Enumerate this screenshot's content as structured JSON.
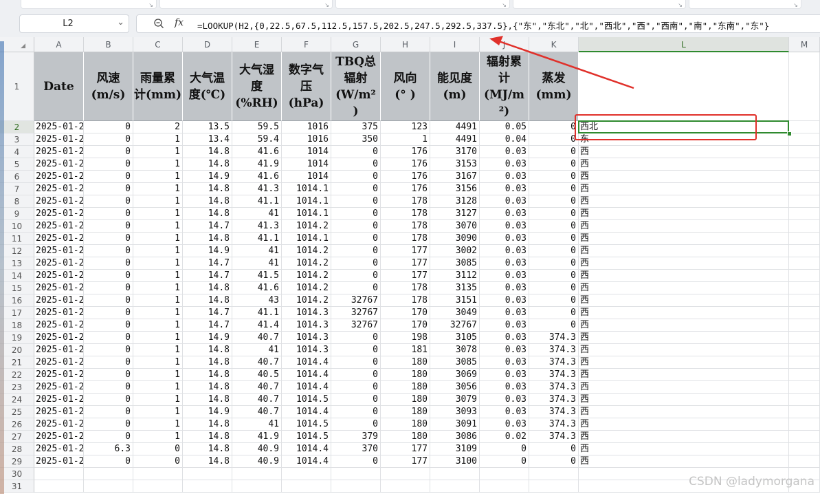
{
  "name_box": {
    "value": "L2"
  },
  "formula_bar": {
    "fx_label": "fx",
    "formula": "=LOOKUP(H2,{0,22.5,67.5,112.5,157.5,202.5,247.5,292.5,337.5},{\"东\",\"东北\",\"北\",\"西北\",\"西\",\"西南\",\"南\",\"东南\",\"东\"}"
  },
  "columns": [
    "A",
    "B",
    "C",
    "D",
    "E",
    "F",
    "G",
    "H",
    "I",
    "J",
    "K",
    "L",
    "M"
  ],
  "selected_column": "L",
  "selected_row": 2,
  "headers": [
    "Date",
    "风速\n(m/s)",
    "雨量累\n计(mm)",
    "大气温\n度(℃)",
    "大气湿\n度\n(%RH)",
    "数字气\n压\n(hPa)",
    "TBQ总\n辐射\n(W/m²\n)",
    "风向\n(° )",
    "能见度\n(m)",
    "辐射累\n计\n(MJ/m\n²)",
    "蒸发\n(mm)"
  ],
  "rows": [
    [
      "2025-01-2",
      "0",
      "2",
      "13.5",
      "59.5",
      "1016",
      "375",
      "123",
      "4491",
      "0.05",
      "0",
      "西北"
    ],
    [
      "2025-01-2",
      "0",
      "1",
      "13.4",
      "59.4",
      "1016",
      "350",
      "1",
      "4491",
      "0.04",
      "0",
      "东"
    ],
    [
      "2025-01-2",
      "0",
      "1",
      "14.8",
      "41.6",
      "1014",
      "0",
      "176",
      "3170",
      "0.03",
      "0",
      "西"
    ],
    [
      "2025-01-2",
      "0",
      "1",
      "14.8",
      "41.9",
      "1014",
      "0",
      "176",
      "3153",
      "0.03",
      "0",
      "西"
    ],
    [
      "2025-01-2",
      "0",
      "1",
      "14.9",
      "41.6",
      "1014",
      "0",
      "176",
      "3167",
      "0.03",
      "0",
      "西"
    ],
    [
      "2025-01-2",
      "0",
      "1",
      "14.8",
      "41.3",
      "1014.1",
      "0",
      "176",
      "3156",
      "0.03",
      "0",
      "西"
    ],
    [
      "2025-01-2",
      "0",
      "1",
      "14.8",
      "41.1",
      "1014.1",
      "0",
      "178",
      "3128",
      "0.03",
      "0",
      "西"
    ],
    [
      "2025-01-2",
      "0",
      "1",
      "14.8",
      "41",
      "1014.1",
      "0",
      "178",
      "3127",
      "0.03",
      "0",
      "西"
    ],
    [
      "2025-01-2",
      "0",
      "1",
      "14.7",
      "41.3",
      "1014.2",
      "0",
      "178",
      "3070",
      "0.03",
      "0",
      "西"
    ],
    [
      "2025-01-2",
      "0",
      "1",
      "14.8",
      "41.1",
      "1014.1",
      "0",
      "178",
      "3090",
      "0.03",
      "0",
      "西"
    ],
    [
      "2025-01-2",
      "0",
      "1",
      "14.9",
      "41",
      "1014.2",
      "0",
      "177",
      "3002",
      "0.03",
      "0",
      "西"
    ],
    [
      "2025-01-2",
      "0",
      "1",
      "14.7",
      "41",
      "1014.2",
      "0",
      "177",
      "3085",
      "0.03",
      "0",
      "西"
    ],
    [
      "2025-01-2",
      "0",
      "1",
      "14.7",
      "41.5",
      "1014.2",
      "0",
      "177",
      "3112",
      "0.03",
      "0",
      "西"
    ],
    [
      "2025-01-2",
      "0",
      "1",
      "14.8",
      "41.6",
      "1014.2",
      "0",
      "178",
      "3135",
      "0.03",
      "0",
      "西"
    ],
    [
      "2025-01-2",
      "0",
      "1",
      "14.8",
      "43",
      "1014.2",
      "32767",
      "178",
      "3151",
      "0.03",
      "0",
      "西"
    ],
    [
      "2025-01-2",
      "0",
      "1",
      "14.7",
      "41.1",
      "1014.3",
      "32767",
      "170",
      "3049",
      "0.03",
      "0",
      "西"
    ],
    [
      "2025-01-2",
      "0",
      "1",
      "14.7",
      "41.4",
      "1014.3",
      "32767",
      "170",
      "32767",
      "0.03",
      "0",
      "西"
    ],
    [
      "2025-01-2",
      "0",
      "1",
      "14.9",
      "40.7",
      "1014.3",
      "0",
      "198",
      "3105",
      "0.03",
      "374.3",
      "西"
    ],
    [
      "2025-01-2",
      "0",
      "1",
      "14.8",
      "41",
      "1014.3",
      "0",
      "181",
      "3078",
      "0.03",
      "374.3",
      "西"
    ],
    [
      "2025-01-2",
      "0",
      "1",
      "14.8",
      "40.7",
      "1014.4",
      "0",
      "180",
      "3085",
      "0.03",
      "374.3",
      "西"
    ],
    [
      "2025-01-2",
      "0",
      "1",
      "14.8",
      "40.5",
      "1014.4",
      "0",
      "180",
      "3069",
      "0.03",
      "374.3",
      "西"
    ],
    [
      "2025-01-2",
      "0",
      "1",
      "14.8",
      "40.7",
      "1014.4",
      "0",
      "180",
      "3056",
      "0.03",
      "374.3",
      "西"
    ],
    [
      "2025-01-2",
      "0",
      "1",
      "14.8",
      "40.7",
      "1014.5",
      "0",
      "180",
      "3079",
      "0.03",
      "374.3",
      "西"
    ],
    [
      "2025-01-2",
      "0",
      "1",
      "14.9",
      "40.7",
      "1014.4",
      "0",
      "180",
      "3093",
      "0.03",
      "374.3",
      "西"
    ],
    [
      "2025-01-2",
      "0",
      "1",
      "14.8",
      "41",
      "1014.5",
      "0",
      "180",
      "3091",
      "0.03",
      "374.3",
      "西"
    ],
    [
      "2025-01-2",
      "0",
      "1",
      "14.8",
      "41.9",
      "1014.5",
      "379",
      "180",
      "3086",
      "0.02",
      "374.3",
      "西"
    ],
    [
      "2025-01-2",
      "6.3",
      "0",
      "14.8",
      "40.9",
      "1014.4",
      "370",
      "177",
      "3109",
      "0",
      "0",
      "西"
    ],
    [
      "2025-01-2",
      "0",
      "0",
      "14.8",
      "40.9",
      "1014.4",
      "0",
      "177",
      "3100",
      "0",
      "0",
      "西"
    ]
  ],
  "row_numbers": [
    "1",
    "2",
    "3",
    "4",
    "5",
    "6",
    "7",
    "8",
    "9",
    "10",
    "11",
    "12",
    "13",
    "14",
    "15",
    "16",
    "17",
    "18",
    "19",
    "20",
    "21",
    "22",
    "23",
    "24",
    "25",
    "26",
    "27",
    "28",
    "29",
    "30",
    "31"
  ],
  "watermark": "CSDN @ladymorgana",
  "colors": {
    "selection": "#2f8a2f",
    "annotation": "#e0302a",
    "header_fill": "#c0c4c8"
  }
}
